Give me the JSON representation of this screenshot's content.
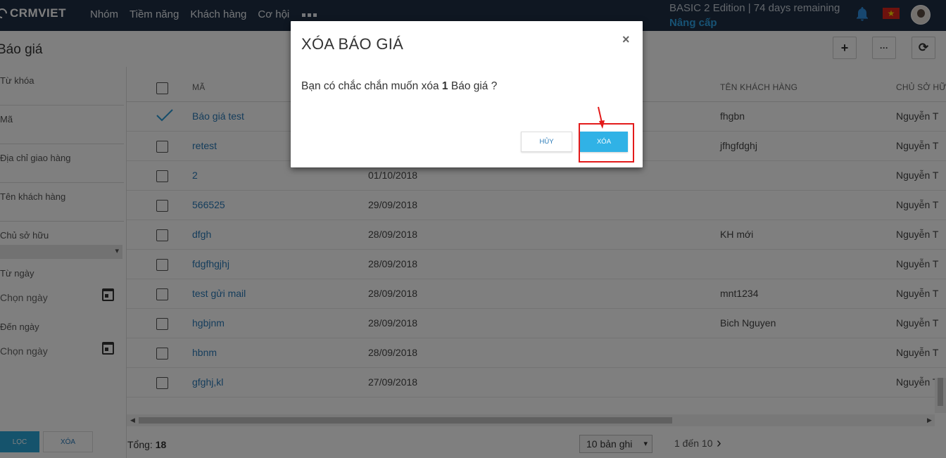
{
  "navbar": {
    "logo": "CRMVIET",
    "items": [
      "Nhóm",
      "Tiềm năng",
      "Khách hàng",
      "Cơ hội"
    ],
    "edition": "BASIC 2 Edition | 74 days remaining",
    "upgrade": "Nâng cấp"
  },
  "page": {
    "title": "Báo giá",
    "tools": {
      "add": "+",
      "more": "···",
      "refresh": "⟳"
    }
  },
  "filters": {
    "keyword": "Từ khóa",
    "code": "Mã",
    "address": "Địa chỉ giao hàng",
    "customer": "Tên khách hàng",
    "owner": "Chủ sở hữu",
    "from_date": "Từ ngày",
    "from_placeholder": "Chọn ngày",
    "to_date": "Đến ngày",
    "to_placeholder": "Chọn ngày",
    "filter_button": "LỌC",
    "clear_button": "XÓA"
  },
  "table": {
    "columns": [
      "MÃ",
      "TÊN KHÁCH HÀNG",
      "CHỦ SỞ HỮU"
    ],
    "rows": [
      {
        "code": "Báo giá test",
        "date": "",
        "customer": "fhgbn",
        "owner": "Nguyễn T",
        "checked": true
      },
      {
        "code": "retest",
        "date": "",
        "customer": "jfhgfdghj",
        "owner": "Nguyễn T",
        "checked": false
      },
      {
        "code": "2",
        "date": "01/10/2018",
        "customer": "",
        "owner": "Nguyễn T",
        "checked": false
      },
      {
        "code": "566525",
        "date": "29/09/2018",
        "customer": "",
        "owner": "Nguyễn T",
        "checked": false
      },
      {
        "code": "dfgh",
        "date": "28/09/2018",
        "customer": "KH mới",
        "owner": "Nguyễn T",
        "checked": false
      },
      {
        "code": "fdgfhgjhj",
        "date": "28/09/2018",
        "customer": "",
        "owner": "Nguyễn T",
        "checked": false
      },
      {
        "code": "test gửi mail",
        "date": "28/09/2018",
        "customer": "mnt1234",
        "owner": "Nguyễn T",
        "checked": false
      },
      {
        "code": "hgbjnm",
        "date": "28/09/2018",
        "customer": "Bich Nguyen",
        "owner": "Nguyễn T",
        "checked": false
      },
      {
        "code": "hbnm",
        "date": "28/09/2018",
        "customer": "",
        "owner": "Nguyễn T",
        "checked": false
      },
      {
        "code": "gfghj,kl",
        "date": "27/09/2018",
        "customer": "",
        "owner": "Nguyễn T",
        "checked": false
      }
    ]
  },
  "footer": {
    "total_label": "Tổng:",
    "total_value": "18",
    "page_size": "10 bản ghi",
    "range": "1 đến 10"
  },
  "modal": {
    "title": "XÓA BÁO GIÁ",
    "message_prefix": "Bạn có chắc chắn muốn xóa",
    "message_count": "1",
    "message_suffix": "Báo giá ?",
    "cancel": "HỦY",
    "confirm": "XÓA"
  },
  "colors": {
    "navbar": "#1f2f44",
    "accent": "#30b2e6",
    "link": "#2a7ab8",
    "highlight": "#e31b1b"
  }
}
